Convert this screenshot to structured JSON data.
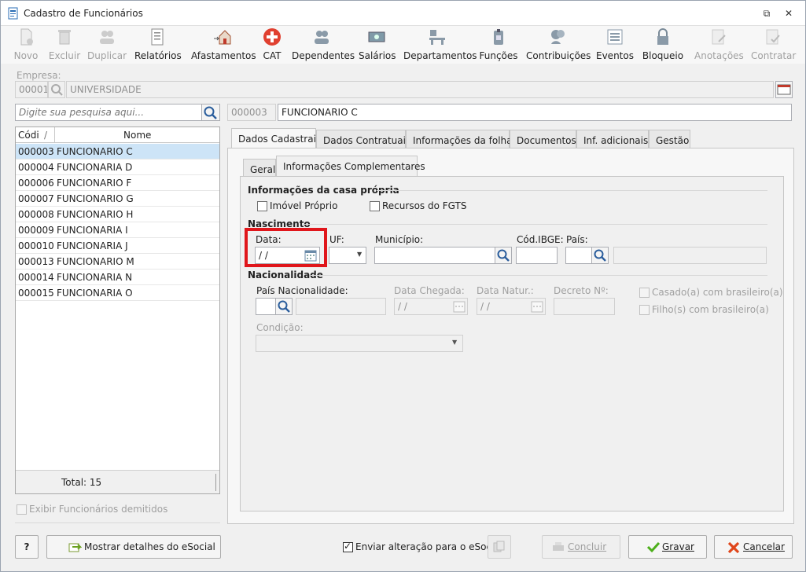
{
  "window": {
    "title": "Cadastro de Funcionários"
  },
  "toolbar": {
    "items": [
      {
        "label": "Novo",
        "icon": "new-document-icon",
        "enabled": false
      },
      {
        "label": "Excluir",
        "icon": "trash-icon",
        "enabled": false
      },
      {
        "label": "Duplicar",
        "icon": "duplicate-users-icon",
        "enabled": false
      },
      {
        "label": "Relatórios",
        "icon": "report-icon",
        "enabled": true
      },
      {
        "label": "Afastamentos",
        "icon": "house-arrow-icon",
        "enabled": true
      },
      {
        "label": "CAT",
        "icon": "red-cross-icon",
        "enabled": true
      },
      {
        "label": "Dependentes",
        "icon": "people-icon",
        "enabled": true
      },
      {
        "label": "Salários",
        "icon": "money-icon",
        "enabled": true
      },
      {
        "label": "Departamentos",
        "icon": "desk-icon",
        "enabled": true
      },
      {
        "label": "Funções",
        "icon": "badge-icon",
        "enabled": true
      },
      {
        "label": "Contribuições",
        "icon": "contributions-icon",
        "enabled": true
      },
      {
        "label": "Eventos",
        "icon": "list-icon",
        "enabled": true
      },
      {
        "label": "Bloqueio",
        "icon": "lock-icon",
        "enabled": true
      },
      {
        "label": "Anotações",
        "icon": "notes-icon",
        "enabled": false
      },
      {
        "label": "Contratar",
        "icon": "contract-icon",
        "enabled": false
      }
    ]
  },
  "empresa": {
    "label": "Empresa:",
    "code": "00001",
    "name": "UNIVERSIDADE"
  },
  "search": {
    "placeholder": "Digite sua pesquisa aqui..."
  },
  "employee": {
    "code": "000003",
    "name": "FUNCIONARIO C"
  },
  "list": {
    "col_code": "Códi",
    "col_name": "Nome",
    "sort_marker": "/",
    "total": "Total: 15",
    "rows": [
      {
        "code": "000003",
        "name": "FUNCIONARIO C"
      },
      {
        "code": "000004",
        "name": "FUNCIONARIA D"
      },
      {
        "code": "000006",
        "name": "FUNCIONARIO F"
      },
      {
        "code": "000007",
        "name": "FUNCIONARIO G"
      },
      {
        "code": "000008",
        "name": "FUNCIONARIO H"
      },
      {
        "code": "000009",
        "name": "FUNCIONARIA I"
      },
      {
        "code": "000010",
        "name": "FUNCIONARIA J"
      },
      {
        "code": "000013",
        "name": "FUNCIONARIO M"
      },
      {
        "code": "000014",
        "name": "FUNCIONARIA N"
      },
      {
        "code": "000015",
        "name": "FUNCIONARIA O"
      }
    ]
  },
  "show_dismissed": "Exibir Funcionários demitidos",
  "tabs": [
    "Dados Cadastrais",
    "Dados Contratuais",
    "Informações da folha",
    "Documentos",
    "Inf. adicionais",
    "Gestão"
  ],
  "subtabs": [
    "Geral",
    "Informações Complementares"
  ],
  "form": {
    "casa_title": "Informações da casa própria",
    "imovel": "Imóvel Próprio",
    "fgts": "Recursos do FGTS",
    "nasc_title": "Nascimento",
    "data_label": "Data:",
    "data_value": "/ /",
    "uf_label": "UF:",
    "municipio_label": "Município:",
    "ibge_label": "Cód.IBGE:",
    "pais_label": "País:",
    "nac_title": "Nacionalidade",
    "pais_nac_label": "País Nacionalidade:",
    "chegada_label": "Data Chegada:",
    "chegada_value": "/ /",
    "natur_label": "Data Natur.:",
    "natur_value": "/ /",
    "decreto_label": "Decreto Nº:",
    "casado": "Casado(a) com brasileiro(a)",
    "filho": "Filho(s) com brasileiro(a)",
    "condicao_label": "Condição:"
  },
  "bottom": {
    "help": "?",
    "esocial_details": "Mostrar detalhes do eSocial",
    "send_change": "Enviar alteração para o eSocial",
    "concluir": "Concluir",
    "gravar": "Gravar",
    "cancelar": "Cancelar"
  },
  "colors": {
    "highlight": "#e0161b",
    "selection": "#cde4f7"
  }
}
